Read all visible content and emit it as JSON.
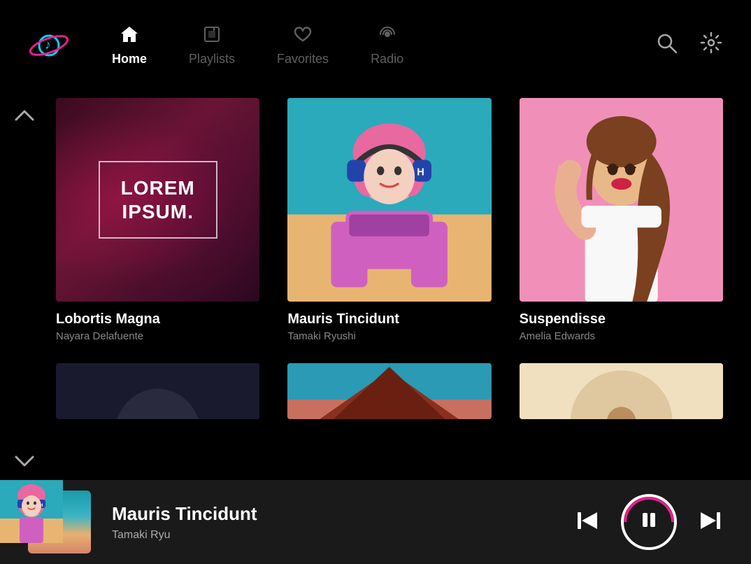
{
  "app": {
    "logo_alt": "Music App Logo"
  },
  "nav": {
    "items": [
      {
        "id": "home",
        "label": "Home",
        "icon": "🏠",
        "active": true
      },
      {
        "id": "playlists",
        "label": "Playlists",
        "icon": "🎵",
        "active": false
      },
      {
        "id": "favorites",
        "label": "Favorites",
        "icon": "♡",
        "active": false
      },
      {
        "id": "radio",
        "label": "Radio",
        "icon": "📻",
        "active": false
      }
    ],
    "search_label": "Search",
    "settings_label": "Settings"
  },
  "albums": [
    {
      "id": 1,
      "title": "Lobortis Magna",
      "artist": "Nayara Delafuente",
      "cover_type": "lorem",
      "lorem_line1": "LOREM",
      "lorem_line2": "IPSUM."
    },
    {
      "id": 2,
      "title": "Mauris Tincidunt",
      "artist": "Tamaki Ryushi",
      "cover_type": "cyan_person"
    },
    {
      "id": 3,
      "title": "Suspendisse",
      "artist": "Amelia Edwards",
      "cover_type": "pink_person"
    }
  ],
  "player": {
    "title": "Mauris Tincidunt",
    "artist": "Tamaki Ryu",
    "prev_label": "Previous",
    "pause_label": "Pause",
    "next_label": "Next"
  }
}
